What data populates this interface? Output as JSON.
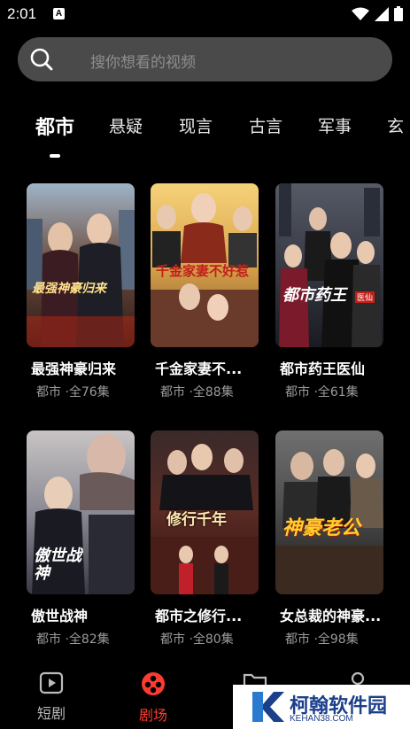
{
  "status_bar": {
    "time": "2:01",
    "notification_badge": "A"
  },
  "search": {
    "placeholder": "搜你想看的视频"
  },
  "tabs": [
    {
      "label": "都市",
      "active": true
    },
    {
      "label": "悬疑",
      "active": false
    },
    {
      "label": "现言",
      "active": false
    },
    {
      "label": "古言",
      "active": false
    },
    {
      "label": "军事",
      "active": false
    },
    {
      "label": "玄",
      "active": false
    }
  ],
  "dramas": [
    {
      "title": "最强神豪归来",
      "meta": "都市 ·全76集",
      "poster_text": "最强神豪归来",
      "poster_bg": "#6b4a3a"
    },
    {
      "title": "千金家妻不...",
      "meta": "都市 ·全88集",
      "poster_text": "千金家妻不好惹",
      "poster_bg": "#d9a34a"
    },
    {
      "title": "都市药王医仙",
      "meta": "都市 ·全61集",
      "poster_text": "都市药王",
      "poster_sub": "医仙",
      "poster_bg": "#3a3a44"
    },
    {
      "title": "傲世战神",
      "meta": "都市 ·全82集",
      "poster_text": "傲世战神",
      "poster_bg": "#8a8a94"
    },
    {
      "title": "都市之修行...",
      "meta": "都市 ·全80集",
      "poster_text": "修行千年",
      "poster_bg": "#5a2a24"
    },
    {
      "title": "女总裁的神豪...",
      "meta": "都市 ·全98集",
      "poster_text": "神豪老公",
      "poster_bg": "#4a4a4a"
    }
  ],
  "bottom_nav": [
    {
      "label": "短剧",
      "icon": "play-icon",
      "active": false
    },
    {
      "label": "剧场",
      "icon": "theater-icon",
      "active": true
    },
    {
      "label": "",
      "icon": "folder-icon",
      "active": false
    },
    {
      "label": "",
      "icon": "user-icon",
      "active": false
    }
  ],
  "watermark": {
    "text": "柯翰软件园",
    "sub": "KEHAN38.COM"
  },
  "colors": {
    "accent": "#ff3b30",
    "background": "#000000",
    "search_bg": "#4a4a4a"
  }
}
